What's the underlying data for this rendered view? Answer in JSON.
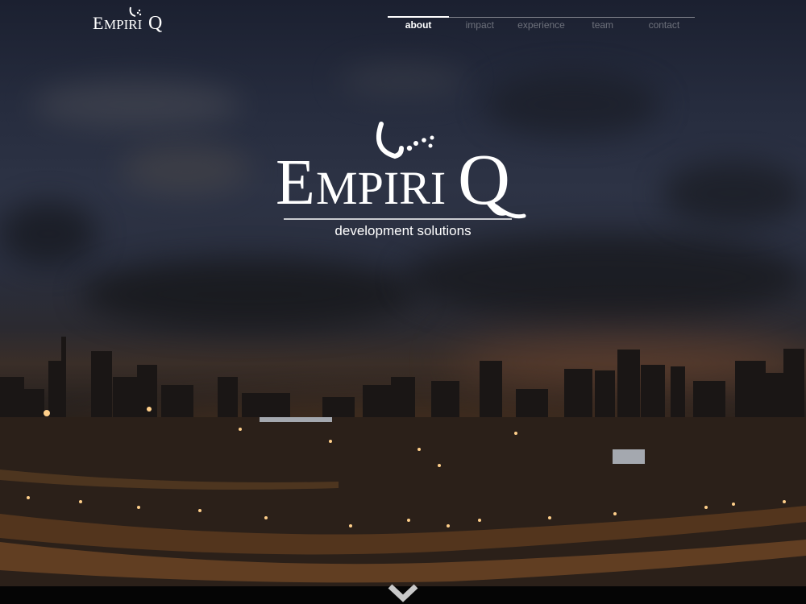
{
  "brand": {
    "logo_text": "EMPIRIQ",
    "tagline": "development solutions"
  },
  "nav": {
    "items": [
      {
        "label": "about",
        "active": true
      },
      {
        "label": "impact",
        "active": false
      },
      {
        "label": "experience",
        "active": false
      },
      {
        "label": "team",
        "active": false
      },
      {
        "label": "contact",
        "active": false
      }
    ]
  },
  "scroll": {
    "icon": "chevron-down-icon"
  },
  "colors": {
    "accent": "#ffffff",
    "nav_inactive": "#6b6f7a",
    "sky": "#262c3e",
    "city_glow": "#c07a35"
  }
}
